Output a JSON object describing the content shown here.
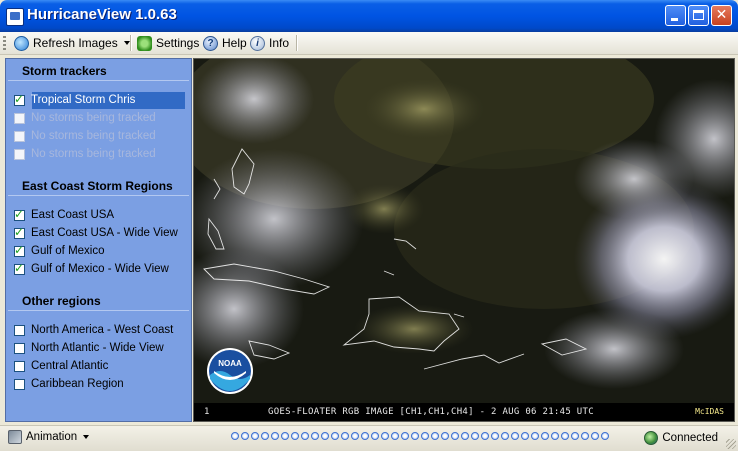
{
  "window": {
    "title": "HurricaneView 1.0.63"
  },
  "toolbar": {
    "refresh_label": "Refresh Images",
    "settings_label": "Settings",
    "help_label": "Help",
    "info_label": "Info"
  },
  "sections": [
    {
      "heading": "Storm trackers",
      "items": [
        {
          "label": "Tropical Storm Chris",
          "checked": true,
          "enabled": true,
          "selected": true
        },
        {
          "label": "No storms being tracked",
          "checked": false,
          "enabled": false
        },
        {
          "label": "No storms being tracked",
          "checked": false,
          "enabled": false
        },
        {
          "label": "No storms being tracked",
          "checked": false,
          "enabled": false
        }
      ]
    },
    {
      "heading": "East Coast Storm Regions",
      "items": [
        {
          "label": "East Coast USA",
          "checked": true,
          "enabled": true
        },
        {
          "label": "East Coast USA - Wide View",
          "checked": true,
          "enabled": true
        },
        {
          "label": "Gulf of Mexico",
          "checked": true,
          "enabled": true
        },
        {
          "label": "Gulf of Mexico - Wide View",
          "checked": true,
          "enabled": true
        }
      ]
    },
    {
      "heading": "Other regions",
      "items": [
        {
          "label": "North America - West Coast",
          "checked": false,
          "enabled": true
        },
        {
          "label": "North Atlantic - Wide View",
          "checked": false,
          "enabled": true
        },
        {
          "label": "Central Atlantic",
          "checked": false,
          "enabled": true
        },
        {
          "label": "Caribbean Region",
          "checked": false,
          "enabled": true
        }
      ]
    }
  ],
  "satellite": {
    "frame_number": "1",
    "caption": "GOES-FLOATER RGB IMAGE [CH1,CH1,CH4] - 2 AUG 06 21:45 UTC",
    "source": "McIDAS",
    "logo_text": "NOAA"
  },
  "statusbar": {
    "animation_label": "Animation",
    "frame_count": 38,
    "connection_label": "Connected"
  },
  "colors": {
    "titlebar": "#0054e3",
    "panel": "#7b9fe3",
    "selection": "#316ac5",
    "check": "#21a121"
  }
}
